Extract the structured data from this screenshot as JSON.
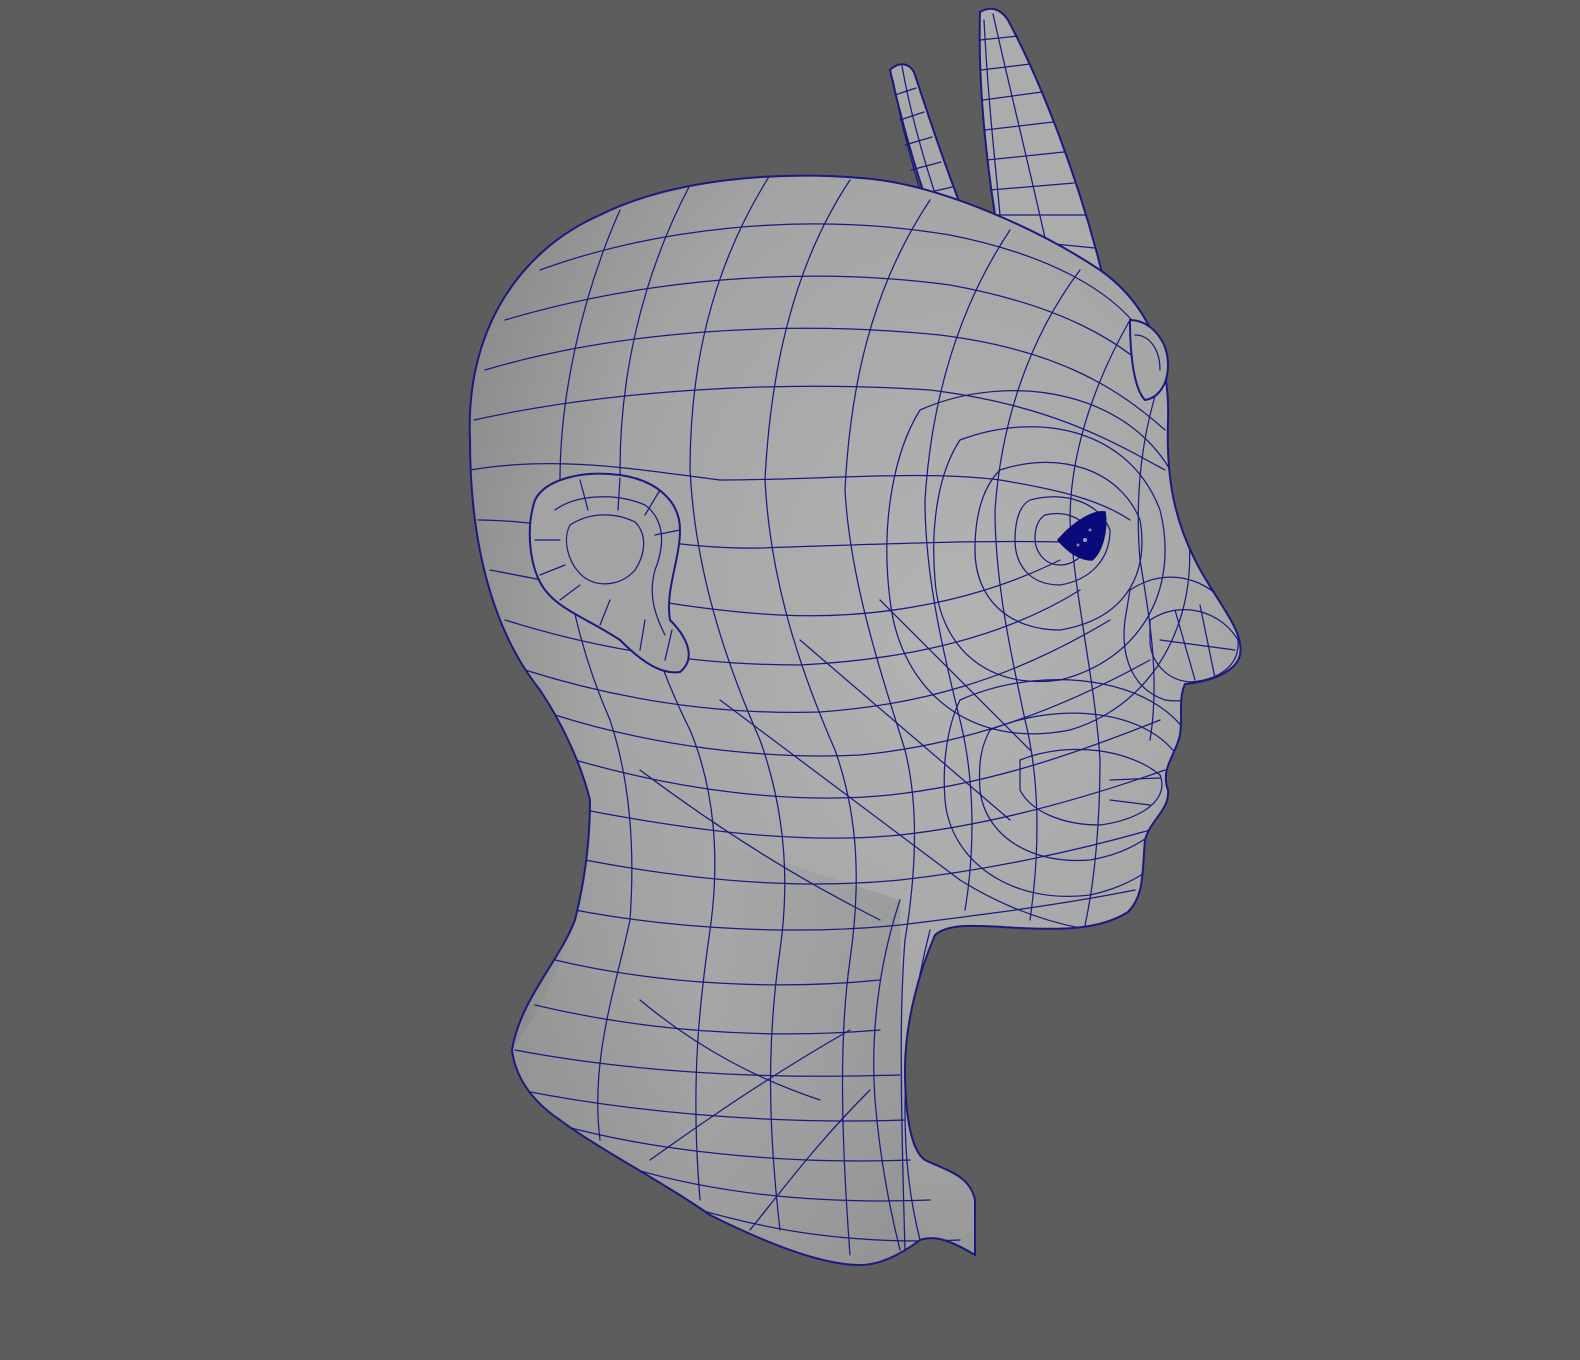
{
  "viewport": {
    "background_color": "#5d5d5d",
    "mesh_fill_color": "#a7a7a7",
    "mesh_shadow_color": "#8c8c8c",
    "wireframe_color": "#1a1a80",
    "eye_color": "#0a0a7a",
    "display_mode": "wireframe-on-shaded"
  },
  "model": {
    "icon": "head-mesh-icon"
  }
}
